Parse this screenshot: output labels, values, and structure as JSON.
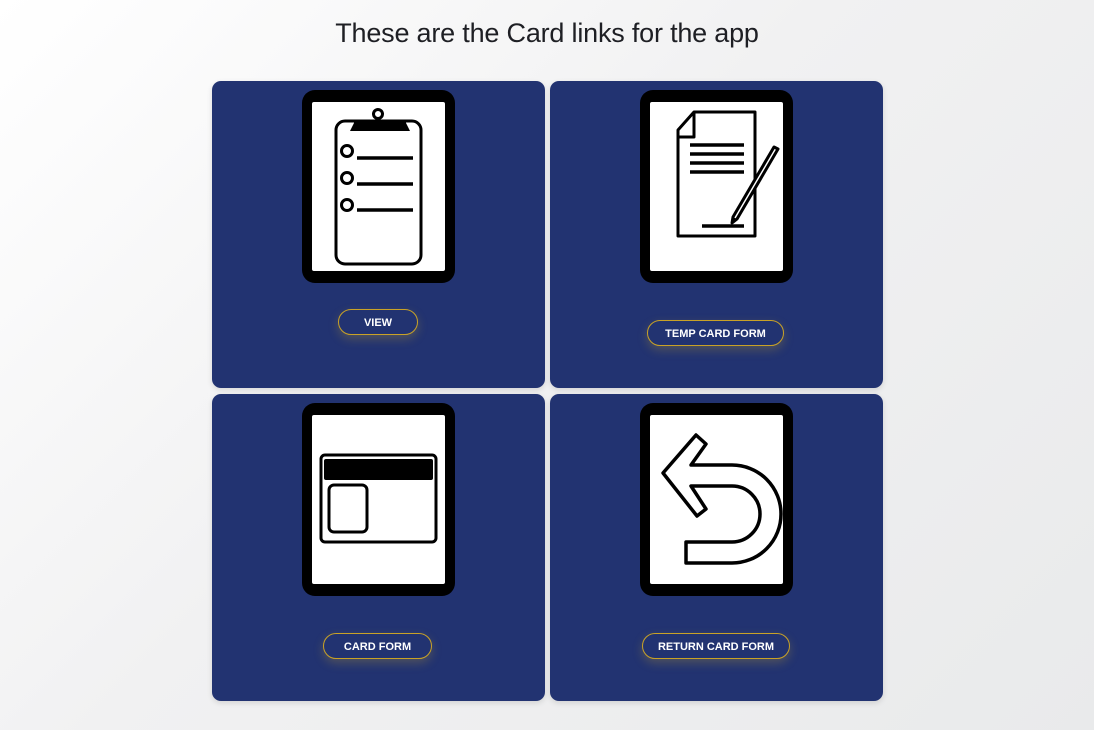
{
  "page": {
    "title": "These are the Card links for the app"
  },
  "cards": [
    {
      "icon": "clipboard-checklist-icon",
      "button_label": "VIEW"
    },
    {
      "icon": "document-pen-icon",
      "button_label": "TEMP CARD FORM"
    },
    {
      "icon": "id-card-icon",
      "button_label": "CARD FORM"
    },
    {
      "icon": "return-arrow-icon",
      "button_label": "RETURN CARD FORM"
    }
  ],
  "colors": {
    "card_background": "#223371",
    "button_border": "#c9a227",
    "tile_frame": "#000000",
    "title_text": "#1e1f24"
  }
}
